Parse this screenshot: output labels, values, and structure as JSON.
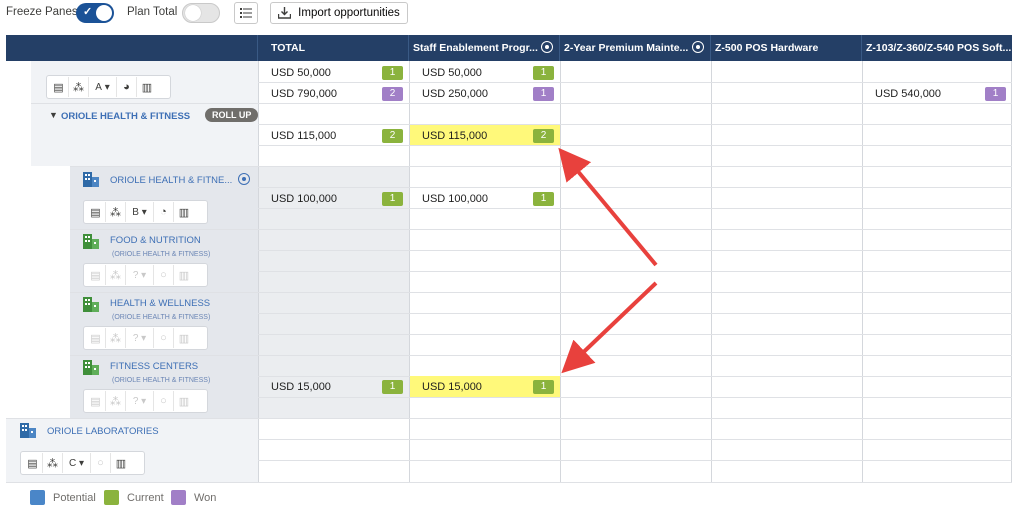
{
  "toolbar": {
    "freeze_panes_label": "Freeze Panes",
    "freeze_panes_on": true,
    "plan_total_label": "Plan Total",
    "plan_total_on": false,
    "import_label": "Import opportunities"
  },
  "columns": {
    "total": "TOTAL",
    "staff": "Staff Enablement Progr...",
    "premium": "2-Year Premium Mainte...",
    "pos_hw": "Z-500 POS Hardware",
    "pos_sw": "Z-103/Z-360/Z-540 POS Soft..."
  },
  "rows": {
    "r1_total": "USD 50,000",
    "r1_total_badge": "1",
    "r1_staff": "USD 50,000",
    "r1_staff_badge": "1",
    "r2_total": "USD 790,000",
    "r2_total_badge": "2",
    "r2_staff": "USD 250,000",
    "r2_staff_badge": "1",
    "r2_sw": "USD 540,000",
    "r2_sw_badge": "1",
    "r3_total": "USD 115,000",
    "r3_total_badge": "2",
    "r3_staff": "USD 115,000",
    "r3_staff_badge": "2",
    "r4_total": "USD 100,000",
    "r4_total_badge": "1",
    "r4_staff": "USD 100,000",
    "r4_staff_badge": "1",
    "r5_total": "USD 15,000",
    "r5_total_badge": "1",
    "r5_staff": "USD 15,000",
    "r5_staff_badge": "1"
  },
  "accounts": {
    "root_letter": "A",
    "oriole_hf": "ORIOLE HEALTH & FITNESS",
    "rollup": "ROLL UP",
    "oriole_hf_child": "ORIOLE HEALTH & FITNE...",
    "child_letter": "B",
    "food": "FOOD & NUTRITION",
    "food_sub": "(ORIOLE HEALTH & FITNESS)",
    "health": "HEALTH & WELLNESS",
    "health_sub": "(ORIOLE HEALTH & FITNESS)",
    "fitness": "FITNESS CENTERS",
    "fitness_sub": "(ORIOLE HEALTH & FITNESS)",
    "labs": "ORIOLE LABORATORIES",
    "labs_letter": "C",
    "unknown_letter": "?"
  },
  "legend": {
    "potential": "Potential",
    "current": "Current",
    "won": "Won"
  },
  "colors": {
    "header": "#243f66",
    "potential": "#4a86c8",
    "current": "#8bb33d",
    "won": "#a17fc7",
    "highlight": "#fff97a",
    "arrow": "#e8413d",
    "toggle_on": "#1b5297"
  },
  "icons": {
    "freeze_toggle": "check-icon",
    "list": "list-icon",
    "import": "download-tray-icon",
    "target": "target-icon",
    "building": "building-icon",
    "expand": "triangle-down-icon"
  }
}
